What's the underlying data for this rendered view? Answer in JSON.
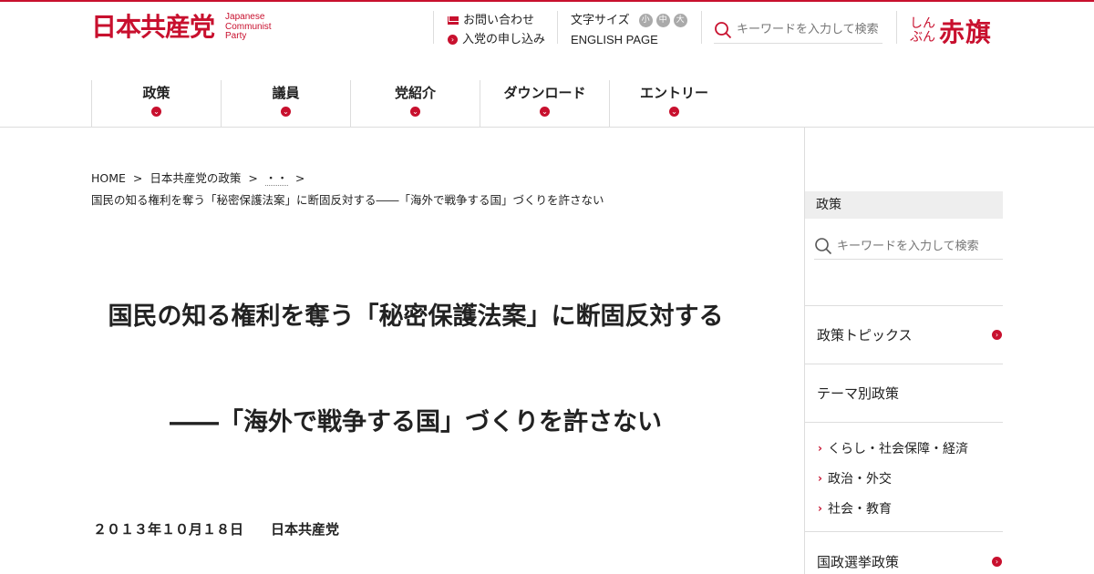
{
  "header": {
    "logo_jp": "日本共産党",
    "logo_en": [
      "Japanese",
      "Communist",
      "Party"
    ],
    "contact_label": "お問い合わせ",
    "join_label": "入党の申し込み",
    "fontsize_label": "文字サイズ",
    "fontsize_small": "小",
    "fontsize_medium": "中",
    "fontsize_large": "大",
    "english_label": "ENGLISH PAGE",
    "search_placeholder": "キーワードを入力して検索",
    "akahata_small_1": "しん",
    "akahata_small_2": "ぶん",
    "akahata_big": "赤旗"
  },
  "nav": {
    "items": [
      {
        "label": "政策"
      },
      {
        "label": "議員"
      },
      {
        "label": "党紹介"
      },
      {
        "label": "ダウンロード"
      },
      {
        "label": "エントリー"
      }
    ]
  },
  "breadcrumb": {
    "home": "HOME",
    "policy": "日本共産党の政策",
    "dots": "・・",
    "sep": ">",
    "current": "国民の知る権利を奪う「秘密保護法案」に断固反対する――「海外で戦争する国」づくりを許さない"
  },
  "article": {
    "title": "国民の知る権利を奪う「秘密保護法案」に断固反対する",
    "subtitle": "――「海外で戦争する国」づくりを許さない",
    "date": "２０１３年１０月１８日",
    "org": "日本共産党"
  },
  "sidebar": {
    "heading": "政策",
    "search_placeholder": "キーワードを入力して検索",
    "topics": "政策トピックス",
    "theme": "テーマ別政策",
    "sub_items": [
      "くらし・社会保障・経済",
      "政治・外交",
      "社会・教育"
    ],
    "election": "国政選挙政策"
  },
  "colors": {
    "brand_red": "#c8102e"
  }
}
